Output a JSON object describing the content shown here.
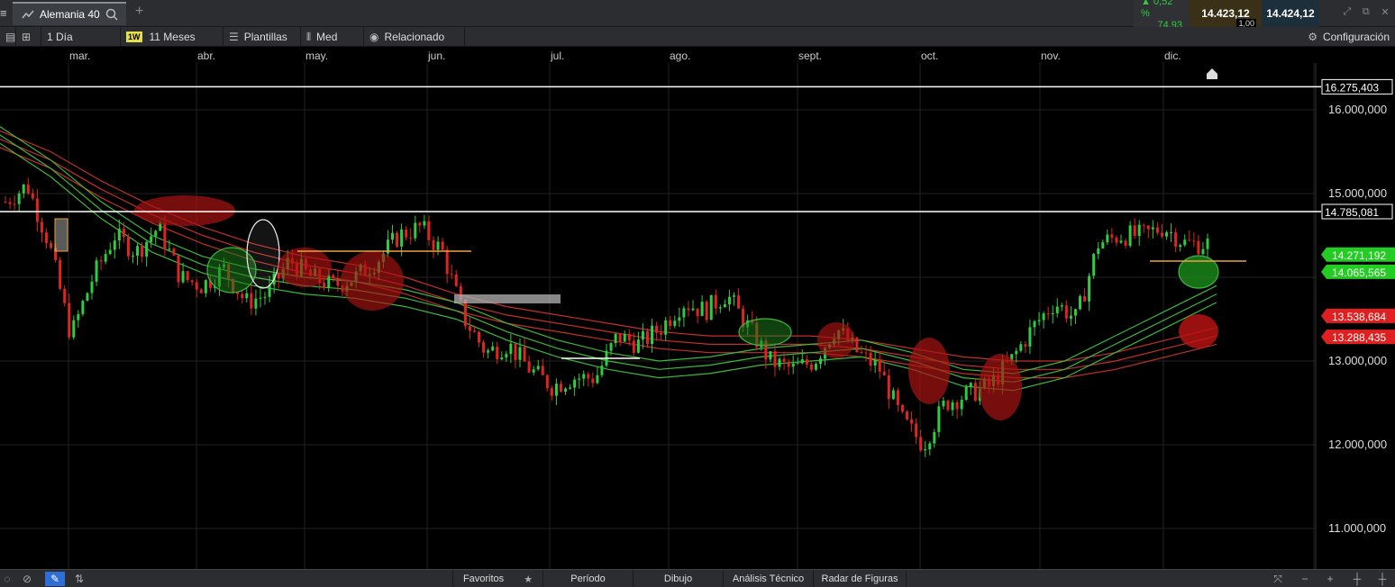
{
  "header": {
    "instrument_tab": "Alemania 40",
    "add_tab": "+",
    "change_pct": "▲ 0,52 %",
    "change_pts": "74,93",
    "sell_price": "14.423,12",
    "lot_size": "1,00",
    "buy_price": "14.424,12"
  },
  "toolbar": {
    "interval": "1 Día",
    "range_badge": "1W",
    "range": "11 Meses",
    "templates": "Plantillas",
    "indicator": "Med",
    "related": "Relacionado",
    "settings": "Configuración"
  },
  "chart_data": {
    "type": "candlestick",
    "instrument": "Alemania 40",
    "months": [
      "mar.",
      "abr.",
      "may.",
      "jun.",
      "jul.",
      "ago.",
      "sept.",
      "oct.",
      "nov.",
      "dic."
    ],
    "y_ticks": [
      "16.000,000",
      "15.000,000",
      "13.000,000",
      "12.000,000",
      "11.000,000"
    ],
    "ylim": [
      10700,
      16550
    ],
    "grid": true,
    "horizontal_lines": [
      {
        "price": 16275.403,
        "label": "16.275,403",
        "color": "#ffffff"
      },
      {
        "price": 14785.081,
        "label": "14.785,081",
        "color": "#ffffff"
      }
    ],
    "price_labels": [
      {
        "price": 14271.192,
        "label": "14.271,192",
        "color": "#22cc22"
      },
      {
        "price": 14065.565,
        "label": "14.065,565",
        "color": "#22cc22"
      },
      {
        "price": 13538.684,
        "label": "13.538,684",
        "color": "#e02020"
      },
      {
        "price": 13288.435,
        "label": "13.288,435",
        "color": "#e02020"
      }
    ],
    "close_path": [
      14900,
      15100,
      14400,
      13300,
      14000,
      14500,
      14300,
      14600,
      14000,
      13900,
      14100,
      13700,
      13800,
      14200,
      14000,
      13900,
      14000,
      14200,
      14500,
      14600,
      14300,
      13500,
      13100,
      13200,
      12900,
      12700,
      12800,
      12800,
      13300,
      13200,
      13400,
      13700,
      13600,
      13800,
      13400,
      13000,
      12900,
      13000,
      13400,
      13100,
      12900,
      12300,
      12000,
      12500,
      12600,
      12700,
      13000,
      13400,
      13700,
      13500,
      14400,
      14500,
      14500,
      14600,
      14400,
      14400
    ],
    "ma_green": [
      [
        15800,
        15400,
        14900,
        14500,
        14250,
        14100,
        14000,
        13950,
        13850,
        13700,
        13450,
        13250,
        13100,
        13000,
        13050,
        13150,
        13200,
        13250,
        13100,
        12900,
        12850,
        13000,
        13300,
        13600,
        13900
      ],
      [
        15700,
        15300,
        14800,
        14400,
        14150,
        14000,
        13900,
        13850,
        13750,
        13600,
        13350,
        13150,
        13000,
        12900,
        12950,
        13050,
        13100,
        13150,
        13000,
        12800,
        12750,
        12900,
        13200,
        13500,
        13800
      ],
      [
        15600,
        15200,
        14700,
        14300,
        14050,
        13900,
        13800,
        13750,
        13650,
        13500,
        13250,
        13050,
        12900,
        12800,
        12850,
        12950,
        13000,
        13050,
        12900,
        12700,
        12650,
        12800,
        13100,
        13400,
        13700
      ]
    ],
    "ma_red": [
      [
        15750,
        15500,
        15150,
        14850,
        14600,
        14400,
        14250,
        14150,
        14000,
        13800,
        13650,
        13550,
        13450,
        13350,
        13300,
        13300,
        13300,
        13250,
        13150,
        13050,
        13000,
        13000,
        13100,
        13250,
        13400
      ],
      [
        15650,
        15400,
        15050,
        14750,
        14500,
        14300,
        14150,
        14050,
        13900,
        13700,
        13550,
        13450,
        13350,
        13250,
        13200,
        13200,
        13200,
        13150,
        13050,
        12950,
        12900,
        12900,
        13000,
        13150,
        13300
      ],
      [
        15550,
        15300,
        14950,
        14650,
        14400,
        14200,
        14050,
        13950,
        13800,
        13600,
        13450,
        13350,
        13250,
        13150,
        13100,
        13100,
        13100,
        13050,
        12950,
        12850,
        12800,
        12800,
        12900,
        13050,
        13200
      ]
    ]
  },
  "bottom": {
    "favorites": "Favoritos",
    "period": "Período",
    "drawing": "Dibujo",
    "technical": "Análisis Técnico",
    "patterns": "Radar de Figuras"
  }
}
